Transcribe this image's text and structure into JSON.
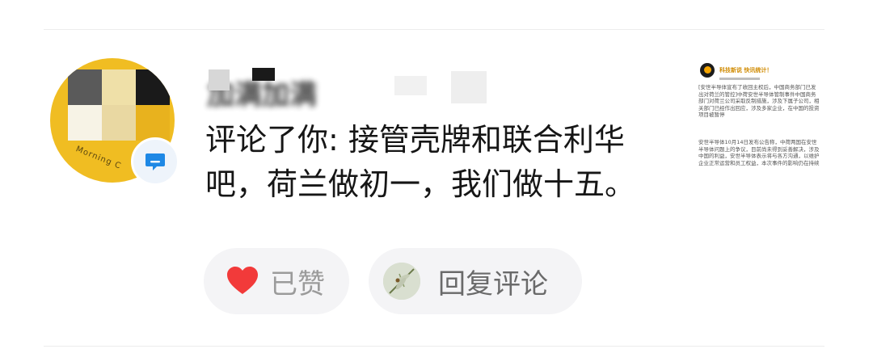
{
  "avatar": {
    "text": "Morning C"
  },
  "user": {
    "name": "加满加满",
    "comment_prefix": "评论了你:",
    "comment_text": "接管壳牌和联合利华吧，荷兰做初一，我们做十五。"
  },
  "actions": {
    "like_label": "已赞",
    "reply_label": "回复评论"
  },
  "thumbnail": {
    "title": "科技新说 快讯统计！",
    "para1": "[安世半导体宣布了收回主权后，中国商务部门已发出对荷兰的管控]中荷安世半导体管制事件中国商务部门对荷兰公司采取反制措施，涉及下属子公司，相关部门已经作出回应，涉及多家企业，在中国的投资项目被暂停",
    "para2": "安世半导体10月14日发布公告称，中荷两国在安世半导体问题上的争议，目前尚未得到妥善解决，涉及中国的利益，安世半导体表示将与各方沟通，以维护企业正常运营和员工权益，本次事件的影响仍在持续"
  },
  "colors": {
    "accent_avatar": "#f0bd22",
    "heart": "#f23a3a",
    "badge": "#1e88e5"
  }
}
